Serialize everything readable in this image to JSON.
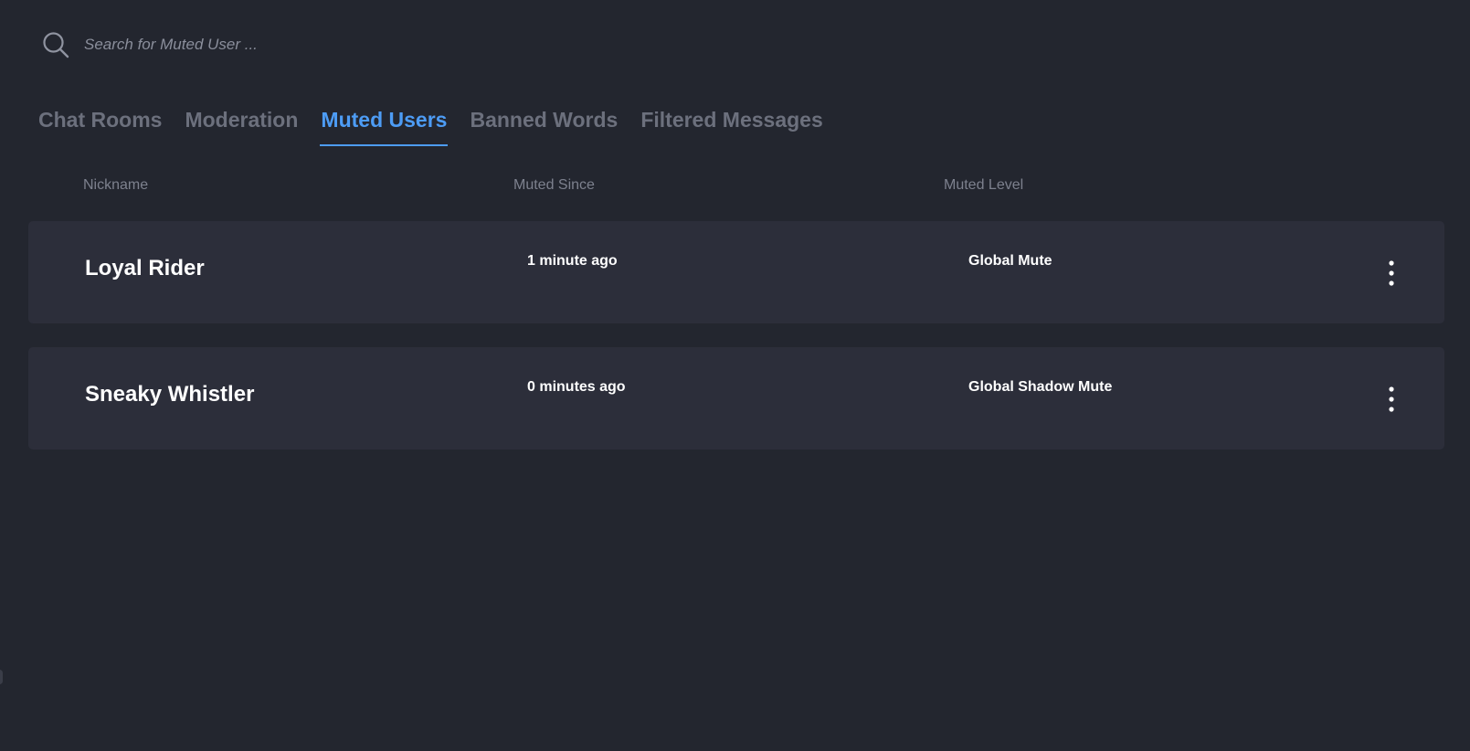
{
  "search": {
    "placeholder": "Search for Muted User ...",
    "value": "",
    "icon": "search-icon"
  },
  "tabs": [
    {
      "label": "Chat Rooms",
      "active": false
    },
    {
      "label": "Moderation",
      "active": false
    },
    {
      "label": "Muted Users",
      "active": true
    },
    {
      "label": "Banned Words",
      "active": false
    },
    {
      "label": "Filtered Messages",
      "active": false
    }
  ],
  "table": {
    "columns": [
      "Nickname",
      "Muted Since",
      "Muted Level"
    ],
    "rows": [
      {
        "nickname": "Loyal Rider",
        "muted_since": "1 minute ago",
        "muted_level": "Global Mute",
        "menu_icon": "more-vertical-icon"
      },
      {
        "nickname": "Sneaky Whistler",
        "muted_since": "0 minutes ago",
        "muted_level": "Global Shadow Mute",
        "menu_icon": "more-vertical-icon"
      }
    ]
  },
  "colors": {
    "background": "#23262f",
    "row_background": "#2c2e3a",
    "accent": "#4d9cf5",
    "tab_inactive": "#6c707d",
    "header_text": "#7d818e"
  }
}
